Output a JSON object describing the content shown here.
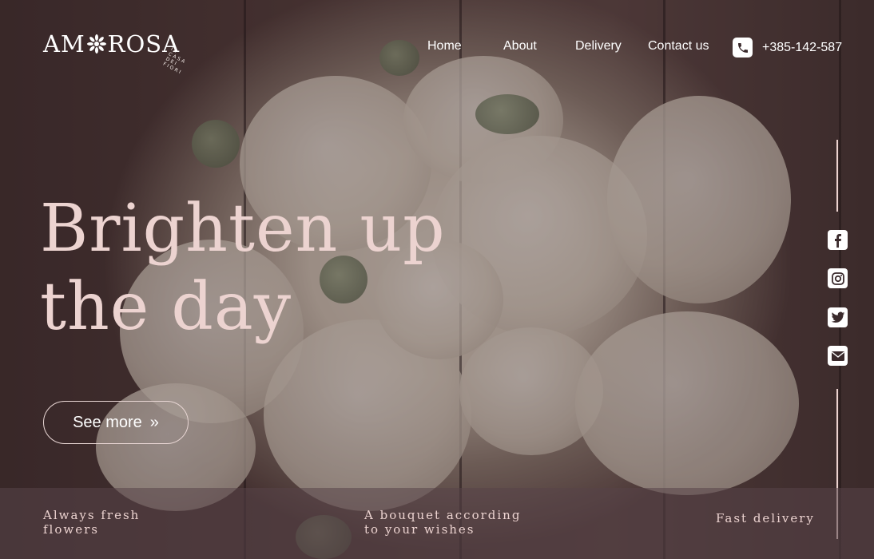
{
  "brand": {
    "name_left": "AM",
    "name_right": "ROSA",
    "tagline": "IL CASA DEI FIORI"
  },
  "nav": {
    "items": [
      {
        "label": "Home"
      },
      {
        "label": "About"
      },
      {
        "label": "Delivery"
      },
      {
        "label": "Contact us"
      }
    ]
  },
  "contact": {
    "phone": "+385-142-587",
    "icon": "phone-icon"
  },
  "hero": {
    "headline_line1": "Brighten up",
    "headline_line2": "the day",
    "cta_label": "See more",
    "cta_icon": "»"
  },
  "social": {
    "items": [
      {
        "icon": "facebook-icon"
      },
      {
        "icon": "instagram-icon"
      },
      {
        "icon": "twitter-icon"
      },
      {
        "icon": "mail-icon"
      }
    ]
  },
  "features": [
    {
      "line1": "Always fresh",
      "line2": "flowers"
    },
    {
      "line1": "A bouquet according",
      "line2": "to your wishes"
    },
    {
      "line1": "Fast delivery",
      "line2": ""
    }
  ],
  "colors": {
    "accent": "#ecd3d0",
    "text": "#ffffff",
    "overlay": "#372629"
  }
}
